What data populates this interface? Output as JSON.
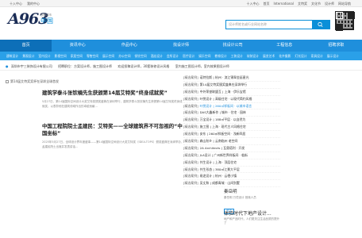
{
  "topbar": {
    "left": [
      "十入中心",
      "我的中心"
    ],
    "right": [
      "十入中心",
      "首页",
      "International",
      "艾特奖",
      "文化节",
      "设计师",
      "网站导航"
    ]
  },
  "header": {
    "logo_text": "A963",
    "city_small": "投稿城市",
    "city_big": "中国",
    "search_placeholder": "设计师姓名或行业网站名称",
    "brand_color": "#1f8fdc"
  },
  "nav": {
    "items": [
      "首页",
      "资讯中心",
      "作品中心",
      "找设计师",
      "找设计公司",
      "工程信息",
      "招聘求职"
    ],
    "active_index": 0
  },
  "subnav": {
    "items": [
      "建筑设计",
      "景观设计",
      "室内设计",
      "影视空间",
      "家居空间",
      "零售空间",
      "展示空间",
      "办公空间",
      "餐饮空间",
      "酒店设计",
      "会所设计",
      "医疗设计",
      "娱乐空间",
      "教育设计",
      "工装设计",
      "软装设计",
      "展览艺术",
      "花卉摄影",
      "灯光设计",
      "家具设计",
      "展示设计"
    ]
  },
  "ticker": {
    "items": [
      "深圳市宇三装饰设计有限公司",
      "招聘职位：方案设计师，施工图设计师",
      "欢迎投稿设计师，30套装修设计风格",
      "室内施工图设计师，室内效果图设计师"
    ]
  },
  "main": {
    "broken_image_alt": "第14届艾特奖奖杯在深圳全球首发",
    "articles": [
      {
        "title": "建筑学泰斗张钦楠先生获颁第14届艾特奖“终身成就奖”",
        "desc": "5月27日，第14届国际空间设计大奖艾特奖颁奖盛典在深圳举行，建筑学泰斗张钦楠先生获颁第14届艾特奖终身成就奖，以表彰他在建筑领域作出的卓越贡献..."
      },
      {
        "title": "中国工程院院士孟建民：艾特奖——全球建筑界不可忽视的“中国坐标”",
        "desc": "2025年5月27日，全球设计界年度盛事——第14届国际空间设计大奖艾特奖（IDEA-TOPS）颁奖盛典在深圳举办，孟建民院士出席并发表讲话..."
      }
    ]
  },
  "list": {
    "rows": [
      {
        "cat": "[精选案例]",
        "text": "诺特拉斯 | 杭州 · 滨江锦翠金延星光",
        "hl": false
      },
      {
        "cat": "[精选案例]",
        "text": "第14届艾特奖颁奖盛典在深圳举行",
        "hl": false
      },
      {
        "cat": "[精选案例]",
        "text": "中外荣誉联盟互 | 上海 · 伊乐宝馆",
        "hl": false
      },
      {
        "cat": "[精选案例]",
        "text": "叶悦设计 | 高级住宅 · 以现代简约风格",
        "hl": false
      },
      {
        "cat": "[精选案例]",
        "text": "叶悦设计 | 260㎡样板间 · 以城市语言",
        "hl": true
      },
      {
        "cat": "[精选案例]",
        "text": "DAS大鑫新作 | 城市 · 住宅 · 园林",
        "hl": false
      },
      {
        "cat": "[精选案例]",
        "text": "万宝设计 | 188㎡平层 · 以自然为",
        "hl": false
      },
      {
        "cat": "[精选案例]",
        "text": "施工图 | 上海 · 现代主义风格住宅",
        "hl": false
      },
      {
        "cat": "[精选案例]",
        "text": "安东 | 260㎡样板空间 · 浅新四居",
        "hl": false
      },
      {
        "cat": "[精选案例]",
        "text": "森山秋乡 | 云南临州 老空间",
        "hl": false
      },
      {
        "cat": "[精选案例]",
        "text": "2A Architects | 瓦奥塔利 · 开发",
        "hl": false
      },
      {
        "cat": "[精选案例]",
        "text": "JLA设计 | 广州新世界样板间 · 临街",
        "hl": false
      },
      {
        "cat": "[精选案例]",
        "text": "共生设计 | 上海 · 顶层住宅",
        "hl": false
      },
      {
        "cat": "[精选案例]",
        "text": "共生形态 | 380㎡江景大平层",
        "hl": false
      },
      {
        "cat": "[精选案例]",
        "text": "易迩设计 | 杭州 · 云栖小镇",
        "hl": false
      },
      {
        "cat": "[精选案例]",
        "text": "吴丈和 | 成都青城 · 山间别墅",
        "hl": false
      }
    ]
  },
  "card": {
    "name": "秦岳明",
    "role": "秦岳明 万境设计 首席人员",
    "tag": "关注"
  },
  "feature": {
    "title": "体验时代下地产设计...",
    "desc": "地产和产品时代，人们更关注生活品质的提升了"
  }
}
